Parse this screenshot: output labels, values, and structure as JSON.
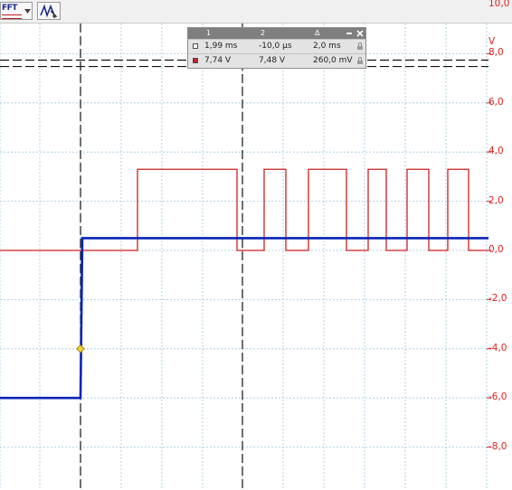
{
  "toolbar": {
    "fft_button_label": "FFT",
    "dropdown_icon": "chevron-down-icon",
    "signal_button_icon": "waveform-icon"
  },
  "cursor_table": {
    "headers": [
      "1",
      "2",
      "Δ"
    ],
    "rows": [
      {
        "marker_color": "#ffffff",
        "c1": "1,99 ms",
        "c2": "-10,0 µs",
        "delta": "2,0 ms"
      },
      {
        "marker_color": "#cc1f1f",
        "c1": "7,74 V",
        "c2": "7,48 V",
        "delta": "260,0 mV"
      }
    ],
    "minimize_icon": "minimize-icon",
    "close_icon": "close-icon",
    "lock_icon": "lock-icon"
  },
  "scale": {
    "unit": "V",
    "ticks": [
      "10,0",
      "8,0",
      "6,0",
      "4,0",
      "2,0",
      "0,0",
      "-2,0",
      "-4,0",
      "-6,0",
      "-8,0"
    ],
    "tick_values": [
      10,
      8,
      6,
      4,
      2,
      0,
      -2,
      -4,
      -6,
      -8
    ]
  },
  "cursors": {
    "horizontal_level_1": 7.74,
    "horizontal_level_2": 7.48
  },
  "colors": {
    "channel_red": "#cc1f1f",
    "channel_blue": "#0a24b8",
    "grid": "#9dc8de",
    "trigger_marker": "#f2d22e",
    "scale_text": "#e02020"
  }
}
